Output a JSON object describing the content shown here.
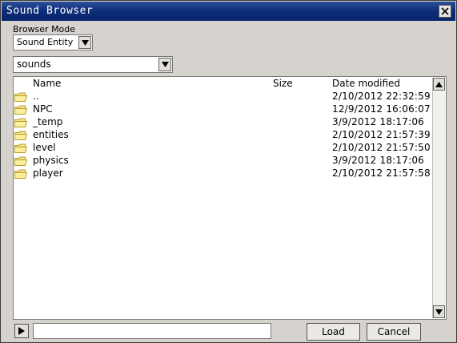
{
  "window": {
    "title": "Sound Browser"
  },
  "browser_mode": {
    "label": "Browser Mode",
    "selected": "Sound Entity"
  },
  "path": {
    "selected": "sounds"
  },
  "columns": {
    "name": "Name",
    "size": "Size",
    "date": "Date modified"
  },
  "rows": [
    {
      "name": "..",
      "date": "2/10/2012 22:32:59",
      "icon": "folder-icon"
    },
    {
      "name": "NPC",
      "date": "12/9/2012 16:06:07",
      "icon": "folder-icon"
    },
    {
      "name": "_temp",
      "date": "3/9/2012 18:17:06",
      "icon": "folder-icon"
    },
    {
      "name": "entities",
      "date": "2/10/2012 21:57:39",
      "icon": "folder-icon"
    },
    {
      "name": "level",
      "date": "2/10/2012 21:57:50",
      "icon": "folder-icon"
    },
    {
      "name": "physics",
      "date": "3/9/2012 18:17:06",
      "icon": "folder-icon"
    },
    {
      "name": "player",
      "date": "2/10/2012 21:57:58",
      "icon": "folder-icon"
    }
  ],
  "footer": {
    "filename_value": "",
    "load_label": "Load",
    "cancel_label": "Cancel"
  },
  "colors": {
    "titlebar": "#0c2c78",
    "dialog_bg": "#d6d3ce",
    "folder_fill": "#f6e58a",
    "folder_stroke": "#b89b2c"
  }
}
